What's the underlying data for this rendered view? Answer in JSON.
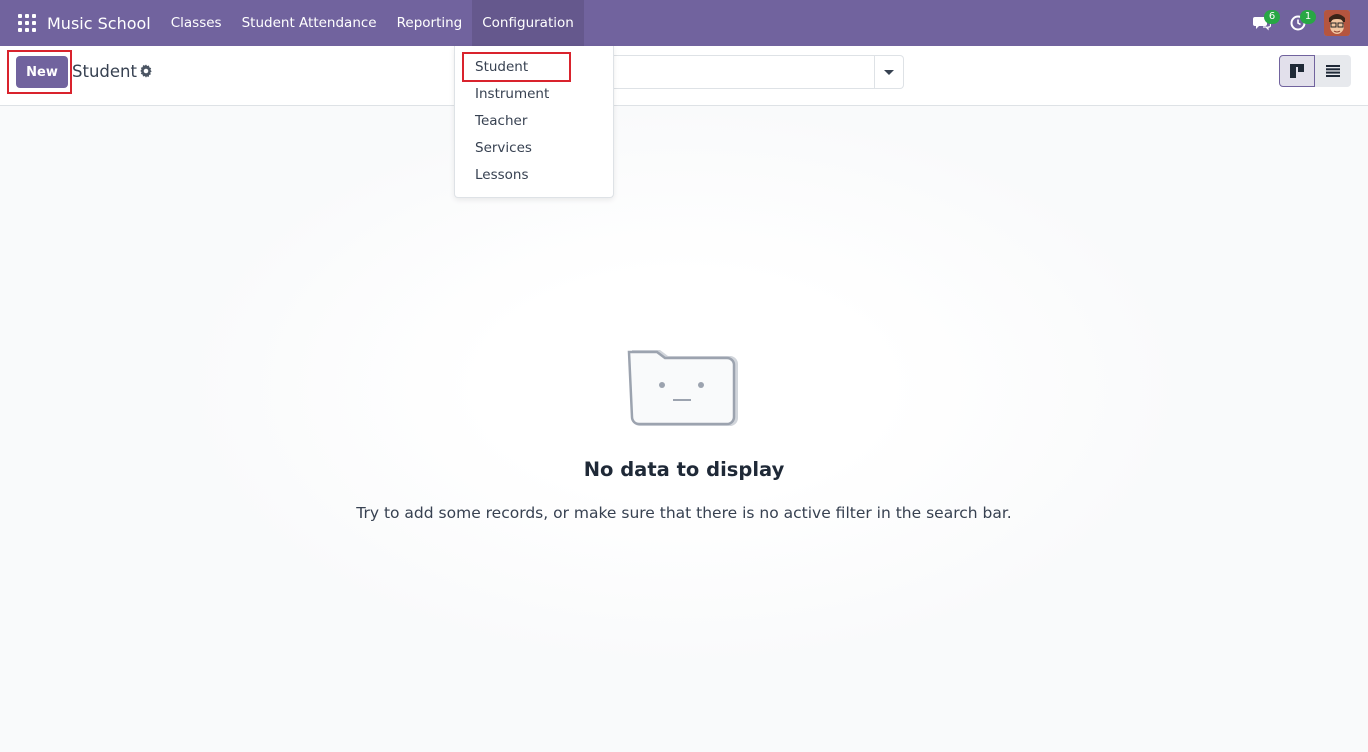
{
  "navbar": {
    "app_name": "Music School",
    "menu": [
      {
        "label": "Classes"
      },
      {
        "label": "Student Attendance"
      },
      {
        "label": "Reporting"
      },
      {
        "label": "Configuration"
      }
    ],
    "messages_badge": "6",
    "activities_badge": "1",
    "icons": {
      "apps": "apps-grid-icon",
      "messages": "chat-icon",
      "activities": "clock-icon",
      "avatar": "user-avatar"
    }
  },
  "control_panel": {
    "new_label": "New",
    "breadcrumb": "Student",
    "settings_icon": "gear-icon",
    "search_placeholder": "",
    "views": [
      "kanban",
      "list"
    ]
  },
  "dropdown": {
    "items": [
      {
        "label": "Student"
      },
      {
        "label": "Instrument"
      },
      {
        "label": "Teacher"
      },
      {
        "label": "Services"
      },
      {
        "label": "Lessons"
      }
    ]
  },
  "empty_state": {
    "title": "No data to display",
    "text": "Try to add some records, or make sure that there is no active filter in the search bar."
  },
  "colors": {
    "brand": "#71639e",
    "highlight": "#d9232d",
    "badge": "#28a745"
  }
}
